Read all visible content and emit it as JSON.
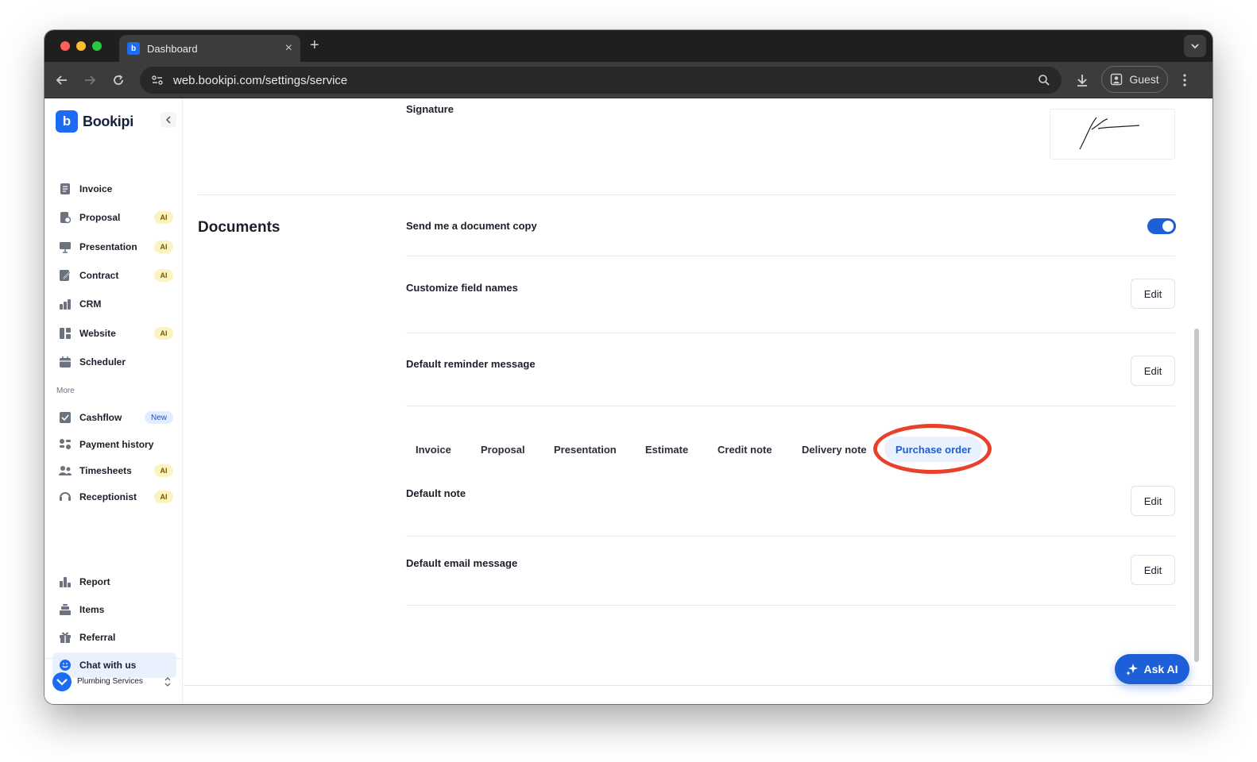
{
  "browser": {
    "tab_title": "Dashboard",
    "url": "web.bookipi.com/settings/service",
    "profile_label": "Guest"
  },
  "sidebar": {
    "brand": "Bookipi",
    "items": [
      {
        "label": "Invoice",
        "icon": "invoice-icon"
      },
      {
        "label": "Proposal",
        "icon": "proposal-icon",
        "badge": "AI"
      },
      {
        "label": "Presentation",
        "icon": "presentation-icon",
        "badge": "AI"
      },
      {
        "label": "Contract",
        "icon": "contract-icon",
        "badge": "AI"
      },
      {
        "label": "CRM",
        "icon": "crm-icon"
      },
      {
        "label": "Website",
        "icon": "website-icon",
        "badge": "AI"
      },
      {
        "label": "Scheduler",
        "icon": "scheduler-icon"
      }
    ],
    "more_label": "More",
    "more_items": [
      {
        "label": "Cashflow",
        "icon": "cashflow-icon",
        "badge": "New"
      },
      {
        "label": "Payment history",
        "icon": "payment-history-icon"
      },
      {
        "label": "Timesheets",
        "icon": "timesheets-icon",
        "badge": "AI"
      },
      {
        "label": "Receptionist",
        "icon": "receptionist-icon",
        "badge": "AI"
      }
    ],
    "bottom_items": [
      {
        "label": "Report",
        "icon": "report-icon"
      },
      {
        "label": "Items",
        "icon": "items-icon"
      },
      {
        "label": "Referral",
        "icon": "gift-icon"
      },
      {
        "label": "Chat with us",
        "icon": "chat-icon",
        "active": true
      }
    ],
    "company": "Plumbing Services"
  },
  "main": {
    "signature_label": "Signature",
    "section_title": "Documents",
    "send_copy_label": "Send me a document copy",
    "send_copy_enabled": true,
    "customize_field_names_label": "Customize field names",
    "default_reminder_label": "Default reminder message",
    "edit_label": "Edit",
    "doc_tabs": [
      "Invoice",
      "Proposal",
      "Presentation",
      "Estimate",
      "Credit note",
      "Delivery note",
      "Purchase order"
    ],
    "selected_doc_tab": "Purchase order",
    "default_note_label": "Default note",
    "default_email_label": "Default email message",
    "ask_ai_label": "Ask AI"
  },
  "colors": {
    "accent": "#1d5fd6",
    "brand": "#1d6bf3",
    "highlight_ring": "#e8402b",
    "ai_badge": "#fdf3bf"
  }
}
